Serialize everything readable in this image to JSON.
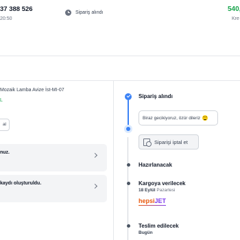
{
  "header": {
    "order_number": "37 388 526",
    "order_time": "20:50",
    "status_label": "Sipariş alındı",
    "price": "540,",
    "price_sub": "Kre"
  },
  "product": {
    "name": "Mozaik Lamba Avize İst-MI-07",
    "price_fragment": "L",
    "chip_label": "al"
  },
  "messages": [
    {
      "text": "nuz."
    },
    {
      "text": "kaydı oluşturuldu."
    }
  ],
  "timeline": {
    "steps": [
      {
        "title": "Sipariş alındı",
        "state": "done"
      },
      {
        "title": "Hazırlanacak",
        "state": "pending"
      },
      {
        "title": "Kargoya verilecek",
        "date": "18 Eylül",
        "weekday": "Pazartesi",
        "state": "pending"
      },
      {
        "title": "Teslim edilecek",
        "date": "Bugün",
        "state": "pending"
      }
    ],
    "apology_message": "Biraz gecikiyoruz, özür dileriz",
    "cancel_button_label": "Siparişi iptal et",
    "carrier_part1": "hepsi",
    "carrier_part2": "JET"
  },
  "colors": {
    "accent": "#3b82f6",
    "price_green": "#16a34a",
    "carrier_orange": "#ea580c",
    "carrier_purple": "#7c3aed"
  },
  "icons": [
    "clock-icon",
    "check-icon",
    "emoji-icon",
    "cancel-order-icon",
    "chevron-right-icon"
  ]
}
